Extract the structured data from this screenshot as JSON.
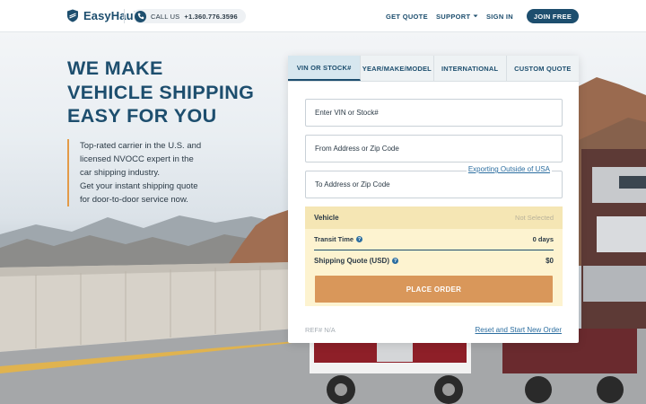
{
  "brand": {
    "name": "EasyHaul"
  },
  "header": {
    "call_label": "CALL US",
    "call_number": "+1.360.776.3596",
    "nav": {
      "get_quote": "GET QUOTE",
      "support": "SUPPORT",
      "sign_in": "SIGN IN",
      "join": "JOIN FREE"
    }
  },
  "hero": {
    "headline_line1": "WE MAKE",
    "headline_line2": "VEHICLE SHIPPING",
    "headline_line3": "EASY FOR YOU",
    "body_lines": [
      "Top-rated carrier in the U.S. and",
      "licensed NVOCC expert in the",
      "car shipping industry.",
      "Get your instant shipping quote",
      "for door-to-door service now."
    ]
  },
  "quote_form": {
    "tabs": [
      "VIN OR STOCK#",
      "YEAR/MAKE/MODEL",
      "INTERNATIONAL",
      "CUSTOM QUOTE"
    ],
    "active_tab": "VIN OR STOCK#",
    "vin_placeholder": "Enter VIN or Stock#",
    "from_placeholder": "From Address or Zip Code",
    "to_placeholder": "To Address or Zip Code",
    "export_link": "Exporting Outside of USA",
    "summary": {
      "vehicle_label": "Vehicle",
      "vehicle_value": "Not Selected",
      "transit_label": "Transit Time",
      "transit_value": "0 days",
      "quote_label": "Shipping Quote (USD)",
      "quote_value": "$0"
    },
    "place_order": "PLACE ORDER",
    "ref": "REF# N/A",
    "reset_link": "Reset and Start New Order"
  },
  "colors": {
    "primary": "#1d4e6e",
    "accent": "#d9975a",
    "summary_bg": "#fdf3d0",
    "link": "#2c6ea0"
  },
  "icons": [
    "shield-logo-icon",
    "phone-icon",
    "chevron-down-icon",
    "info-icon"
  ]
}
